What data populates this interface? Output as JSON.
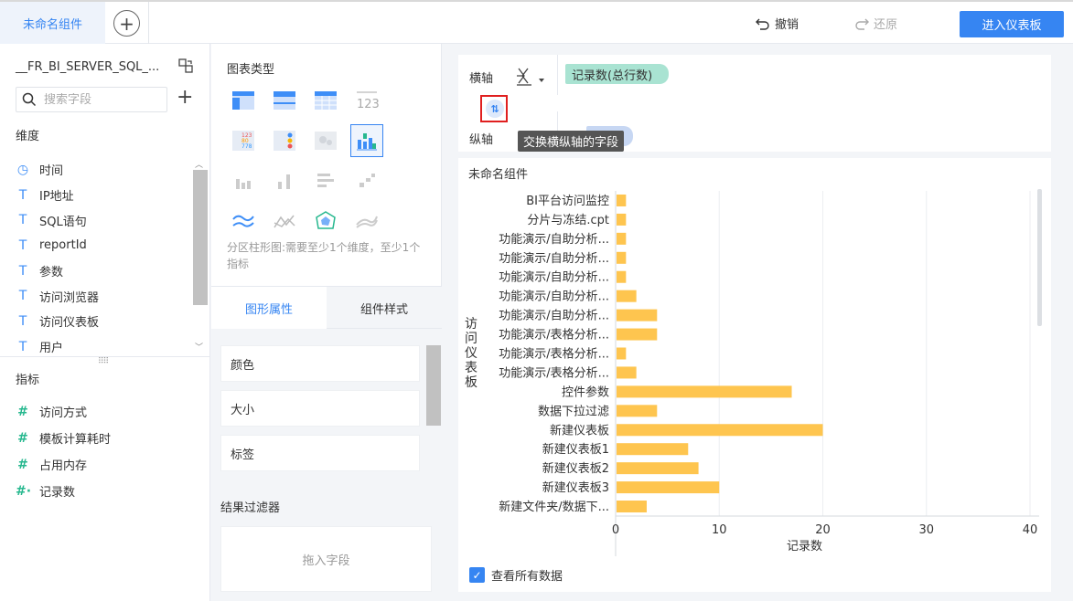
{
  "topbar": {
    "tab_label": "未命名组件",
    "add_tab": "+",
    "undo_label": "撤销",
    "redo_label": "还原",
    "enter_label": "进入仪表板"
  },
  "left": {
    "dataset_name": "__FR_BI_SERVER_SQL_...",
    "search_placeholder": "搜索字段",
    "dimensions_title": "维度",
    "dimensions": [
      {
        "icon": "clock-icon",
        "glyph": "◷",
        "label": "时间"
      },
      {
        "icon": "text-field-icon",
        "glyph": "T",
        "label": "IP地址"
      },
      {
        "icon": "text-field-icon",
        "glyph": "T",
        "label": "SQL语句"
      },
      {
        "icon": "text-field-icon",
        "glyph": "T",
        "label": "reportId"
      },
      {
        "icon": "text-field-icon",
        "glyph": "T",
        "label": "参数"
      },
      {
        "icon": "text-field-icon",
        "glyph": "T",
        "label": "访问浏览器"
      },
      {
        "icon": "text-field-icon",
        "glyph": "T",
        "label": "访问仪表板"
      },
      {
        "icon": "text-field-icon",
        "glyph": "T",
        "label": "用户"
      }
    ],
    "metrics_title": "指标",
    "metrics": [
      {
        "icon": "number-field-icon",
        "glyph": "#",
        "label": "访问方式"
      },
      {
        "icon": "number-field-icon",
        "glyph": "#",
        "label": "模板计算耗时"
      },
      {
        "icon": "number-field-icon",
        "glyph": "#",
        "label": "占用内存"
      },
      {
        "icon": "number-field-icon",
        "glyph": "#·",
        "label": "记录数"
      }
    ]
  },
  "middle": {
    "chart_type_title": "图表类型",
    "hint": "分区柱形图:需要至少1个维度，至少1个指标",
    "tab_shape": "图形属性",
    "tab_style": "组件样式",
    "props": [
      "颜色",
      "大小",
      "标签"
    ],
    "filter_title": "结果过滤器",
    "filter_placeholder": "拖入字段"
  },
  "axes": {
    "x_label": "横轴",
    "y_label": "纵轴",
    "x_field": "记录数(总行数)",
    "y_field": "表板",
    "tooltip": "交换横纵轴的字段",
    "swap_glyph": "⇅"
  },
  "chart": {
    "component_title": "未命名组件",
    "show_all_label": "查看所有数据",
    "bar_color": "#fec54f"
  },
  "chart_data": {
    "type": "bar",
    "orientation": "horizontal",
    "categories": [
      "BI平台访问监控",
      "分片与冻结.cpt",
      "功能演示/自助分析...",
      "功能演示/自助分析...",
      "功能演示/自助分析...",
      "功能演示/自助分析...",
      "功能演示/自助分析...",
      "功能演示/表格分析...",
      "功能演示/表格分析...",
      "功能演示/表格分析...",
      "控件参数",
      "数据下拉过滤",
      "新建仪表板",
      "新建仪表板1",
      "新建仪表板2",
      "新建仪表板3",
      "新建文件夹/数据下..."
    ],
    "values": [
      1,
      1,
      1,
      1,
      1,
      2,
      4,
      4,
      1,
      2,
      17,
      4,
      20,
      7,
      8,
      10,
      3
    ],
    "xlabel": "记录数",
    "ylabel": "访问仪表板",
    "xticks": [
      0,
      10,
      20,
      30,
      40
    ],
    "xlim": [
      0,
      40
    ],
    "grid": true
  }
}
